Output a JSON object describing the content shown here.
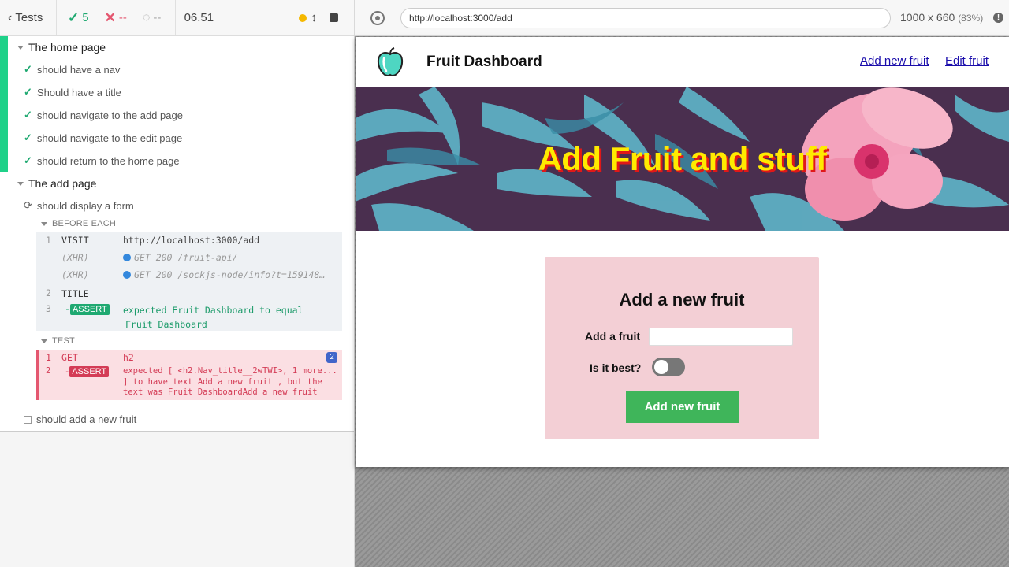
{
  "reporter": {
    "tests_label": "Tests",
    "passed": "5",
    "failed": "--",
    "pending": "--",
    "duration": "06.51"
  },
  "suites": [
    {
      "title": "The home page",
      "tests": [
        "should have a nav",
        "Should have a title",
        "should navigate to the add page",
        "should navigate to the edit page",
        "should return to the home page"
      ]
    },
    {
      "title": "The add page",
      "running_test": "should display a form",
      "pending_test": "should add a new fruit"
    }
  ],
  "before_each": {
    "header": "BEFORE EACH",
    "commands": [
      {
        "num": "1",
        "name": "VISIT",
        "msg": "http://localhost:3000/add"
      },
      {
        "num": "",
        "name": "(XHR)",
        "msg": "GET 200 /fruit-api/"
      },
      {
        "num": "",
        "name": "(XHR)",
        "msg": "GET 200 /sockjs-node/info?t=159148…"
      },
      {
        "num": "2",
        "name": "TITLE",
        "msg": ""
      },
      {
        "num": "3",
        "name": "-ASSERT",
        "msg_line1": "expected  Fruit Dashboard  to equal",
        "msg_line2": "Fruit Dashboard"
      }
    ]
  },
  "test_section": {
    "header": "TEST",
    "commands": [
      {
        "num": "1",
        "name": "GET",
        "msg": "h2",
        "count": "2"
      },
      {
        "num": "2",
        "name": "-ASSERT",
        "line1": "expected  [ <h2.Nav_title__2wTWI>, 1 more...",
        "line2": "]  to have text  Add a new fruit , but the",
        "line3": "text was  Fruit DashboardAdd a new fruit"
      }
    ]
  },
  "browser": {
    "url": "http://localhost:3000/add",
    "viewport": "1000 x 660",
    "scale": "(83%)"
  },
  "app": {
    "nav_title": "Fruit Dashboard",
    "nav_links": [
      "Add new fruit",
      "Edit fruit"
    ],
    "hero_title": "Add Fruit and stuff",
    "form": {
      "heading": "Add a new fruit",
      "fruit_label": "Add a fruit",
      "best_label": "Is it best?",
      "submit": "Add new fruit"
    }
  },
  "colors": {
    "pass": "#1fa971",
    "fail": "#e45770",
    "hero_text": "#ffea00",
    "submit_bg": "#3fb55a",
    "form_bg": "#f3cfd5"
  }
}
